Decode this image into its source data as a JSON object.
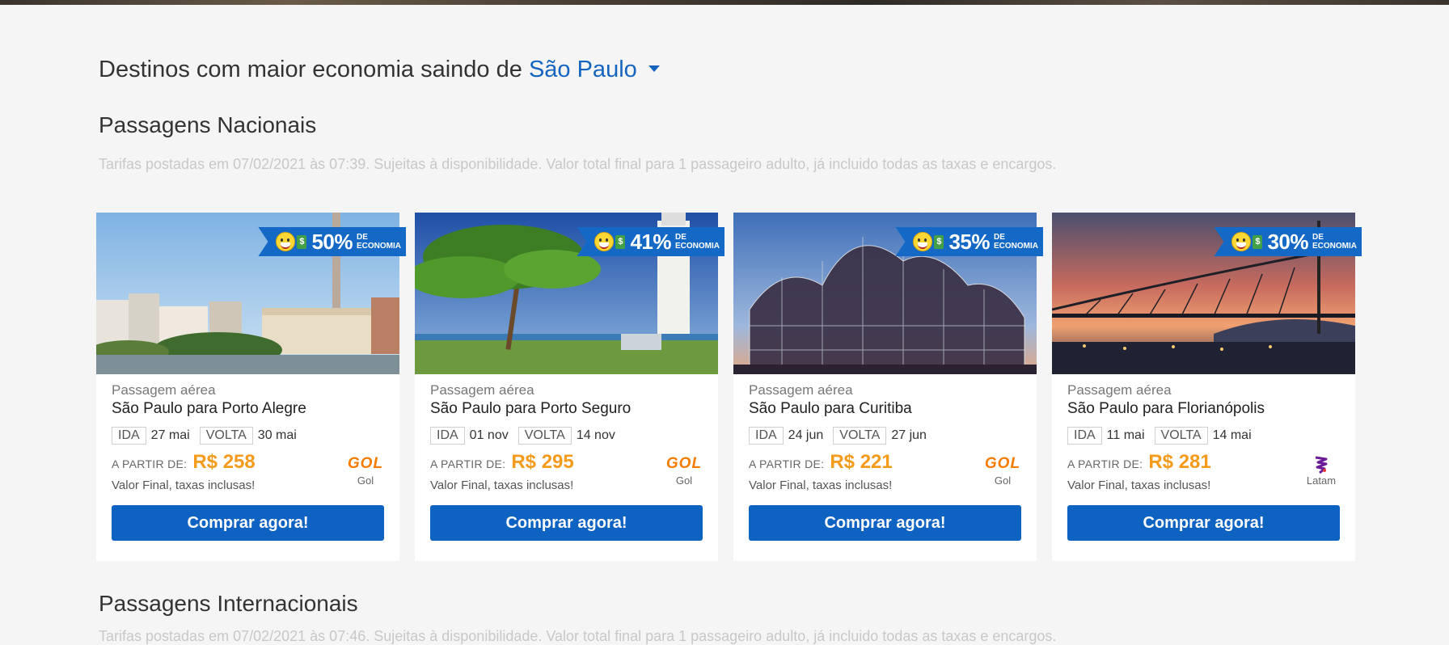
{
  "headline": {
    "text": "Destinos com maior economia saindo de",
    "city": "São Paulo"
  },
  "national": {
    "title": "Passagens Nacionais",
    "note": "Tarifas postadas em 07/02/2021 às 07:39. Sujeitas à disponibilidade. Valor total final para 1 passageiro adulto, já incluido todas as taxas e encargos."
  },
  "international": {
    "title": "Passagens Internacionais",
    "note": "Tarifas postadas em 07/02/2021 às 07:46. Sujeitas à disponibilidade. Valor total final para 1 passageiro adulto, já incluido todas as taxas e encargos."
  },
  "labels": {
    "badge_suffix": "DE ECONOMIA",
    "badge_suffix_1": "DE",
    "badge_suffix_2": "ECONOMIA",
    "ida": "IDA",
    "volta": "VOLTA",
    "from": "A PARTIR DE:",
    "final": "Valor Final, taxas inclusas!",
    "buy": "Comprar agora!",
    "kind": "Passagem aérea"
  },
  "cards": [
    {
      "discount": "50%",
      "route": "São Paulo para Porto Alegre",
      "ida": "27 mai",
      "volta": "30 mai",
      "price": "R$ 258",
      "airline": "Gol",
      "logo": "GOL",
      "scene": "porto-alegre"
    },
    {
      "discount": "41%",
      "route": "São Paulo para Porto Seguro",
      "ida": "01 nov",
      "volta": "14 nov",
      "price": "R$ 295",
      "airline": "Gol",
      "logo": "GOL",
      "scene": "porto-seguro"
    },
    {
      "discount": "35%",
      "route": "São Paulo para Curitiba",
      "ida": "24 jun",
      "volta": "27 jun",
      "price": "R$ 221",
      "airline": "Gol",
      "logo": "GOL",
      "scene": "curitiba"
    },
    {
      "discount": "30%",
      "route": "São Paulo para Florianópolis",
      "ida": "11 mai",
      "volta": "14 mai",
      "price": "R$ 281",
      "airline": "Latam",
      "logo": "",
      "scene": "florianopolis"
    }
  ],
  "colors": {
    "accent": "#0e62c2",
    "price": "#f59b1c",
    "badge": "#1469c7",
    "gol": "#f57c00",
    "latam": "#6a1b9a"
  }
}
